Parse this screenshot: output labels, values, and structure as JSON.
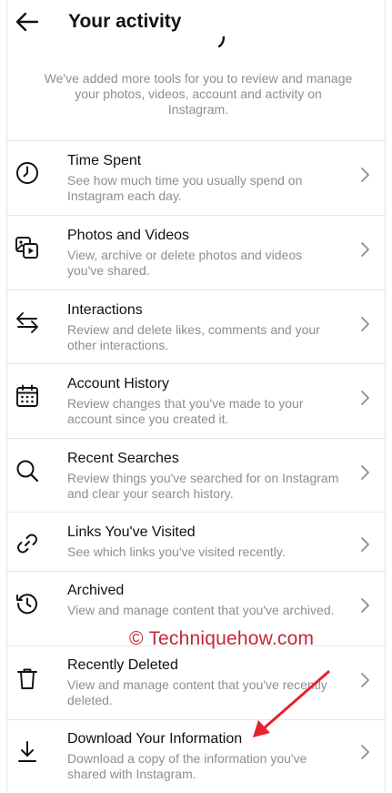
{
  "header": {
    "title": "Your activity"
  },
  "intro": "We've added more tools for you to review and manage your photos, videos, account and activity on Instagram.",
  "items": [
    {
      "title": "Time Spent",
      "description": "See how much time you usually spend on Instagram each day.",
      "icon": "clock-icon"
    },
    {
      "title": "Photos and Videos",
      "description": "View, archive or delete photos and videos you've shared.",
      "icon": "photos-videos-icon"
    },
    {
      "title": "Interactions",
      "description": "Review and delete likes, comments and your other interactions.",
      "icon": "interactions-arrows-icon"
    },
    {
      "title": "Account History",
      "description": "Review changes that you've made to your account since you created it.",
      "icon": "calendar-icon"
    },
    {
      "title": "Recent Searches",
      "description": "Review things you've searched for on Instagram and clear your search history.",
      "icon": "search-icon"
    },
    {
      "title": "Links You've Visited",
      "description": "See which links you've visited recently.",
      "icon": "link-icon"
    },
    {
      "title": "Archived",
      "description": "View and manage content that you've archived.",
      "icon": "archive-history-icon"
    },
    {
      "title": "Recently Deleted",
      "description": "View and manage content that you've recently deleted.",
      "icon": "trash-icon"
    },
    {
      "title": "Download Your Information",
      "description": "Download a copy of the information you've shared with Instagram.",
      "icon": "download-icon"
    }
  ],
  "watermark": "© Techniquehow.com",
  "colors": {
    "text": "#111111",
    "secondary_text": "#8e8e8e",
    "divider": "#e7e7e7",
    "watermark": "#c0283a",
    "annotation_arrow": "#e8212a"
  }
}
